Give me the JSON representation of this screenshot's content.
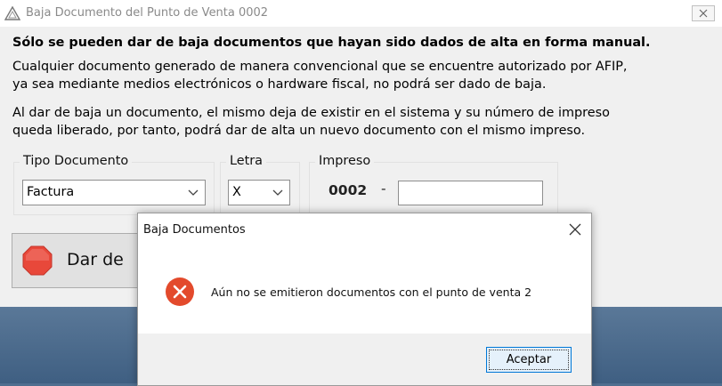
{
  "main_window": {
    "title": "Baja Documento del Punto de Venta 0002",
    "notice_bold": "Sólo se pueden dar de baja documentos que hayan sido dados de alta en forma manual.",
    "notice_lines_1": [
      "Cualquier documento generado de manera convencional que se encuentre autorizado por AFIP,",
      "ya sea mediante medios electrónicos o hardware fiscal, no podrá ser dado de baja."
    ],
    "notice_lines_2": [
      "Al dar de baja un documento, el mismo deja de existir en el sistema y su número de impreso",
      "queda liberado, por tanto, podrá dar de alta un nuevo documento con el mismo impreso."
    ],
    "tipo_documento": {
      "label": "Tipo Documento",
      "value": "Factura"
    },
    "letra": {
      "label": "Letra",
      "value": "X"
    },
    "impreso": {
      "label": "Impreso",
      "prefix": "0002",
      "separator": "-",
      "value": ""
    },
    "action_button": {
      "label": "Dar de",
      "icon": "stop-icon"
    }
  },
  "dialog": {
    "title": "Baja Documentos",
    "message": "Aún no se emitieron documentos con el punto de venta 2",
    "ok_label": "Aceptar",
    "icon": "error-icon"
  },
  "colors": {
    "stop": "#e8483a",
    "error": "#e34a2c",
    "focus": "#0078d7",
    "desktop": "#4f6e8f"
  }
}
